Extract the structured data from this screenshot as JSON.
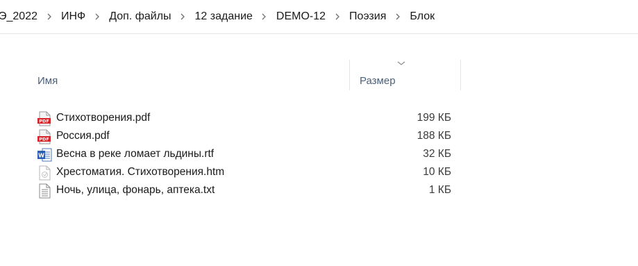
{
  "breadcrumbs": [
    "Э_2022",
    "ИНФ",
    "Доп. файлы",
    "12 задание",
    "DEMO-12",
    "Поэзия",
    "Блок"
  ],
  "columns": {
    "name": "Имя",
    "size": "Размер"
  },
  "files": [
    {
      "name": "Стихотворения.pdf",
      "size": "199 КБ",
      "icon": "pdf-icon"
    },
    {
      "name": "Россия.pdf",
      "size": "188 КБ",
      "icon": "pdf-icon"
    },
    {
      "name": "Весна в реке ломает льдины.rtf",
      "size": "32 КБ",
      "icon": "word-document-icon"
    },
    {
      "name": "Хрестоматия. Стихотворения.htm",
      "size": "10 КБ",
      "icon": "html-document-icon"
    },
    {
      "name": "Ночь, улица, фонарь, аптека.txt",
      "size": "1 КБ",
      "icon": "text-document-icon"
    }
  ],
  "colors": {
    "header_text": "#4c607a",
    "pdf_red": "#d5252b",
    "word_blue": "#2b5fb4"
  }
}
